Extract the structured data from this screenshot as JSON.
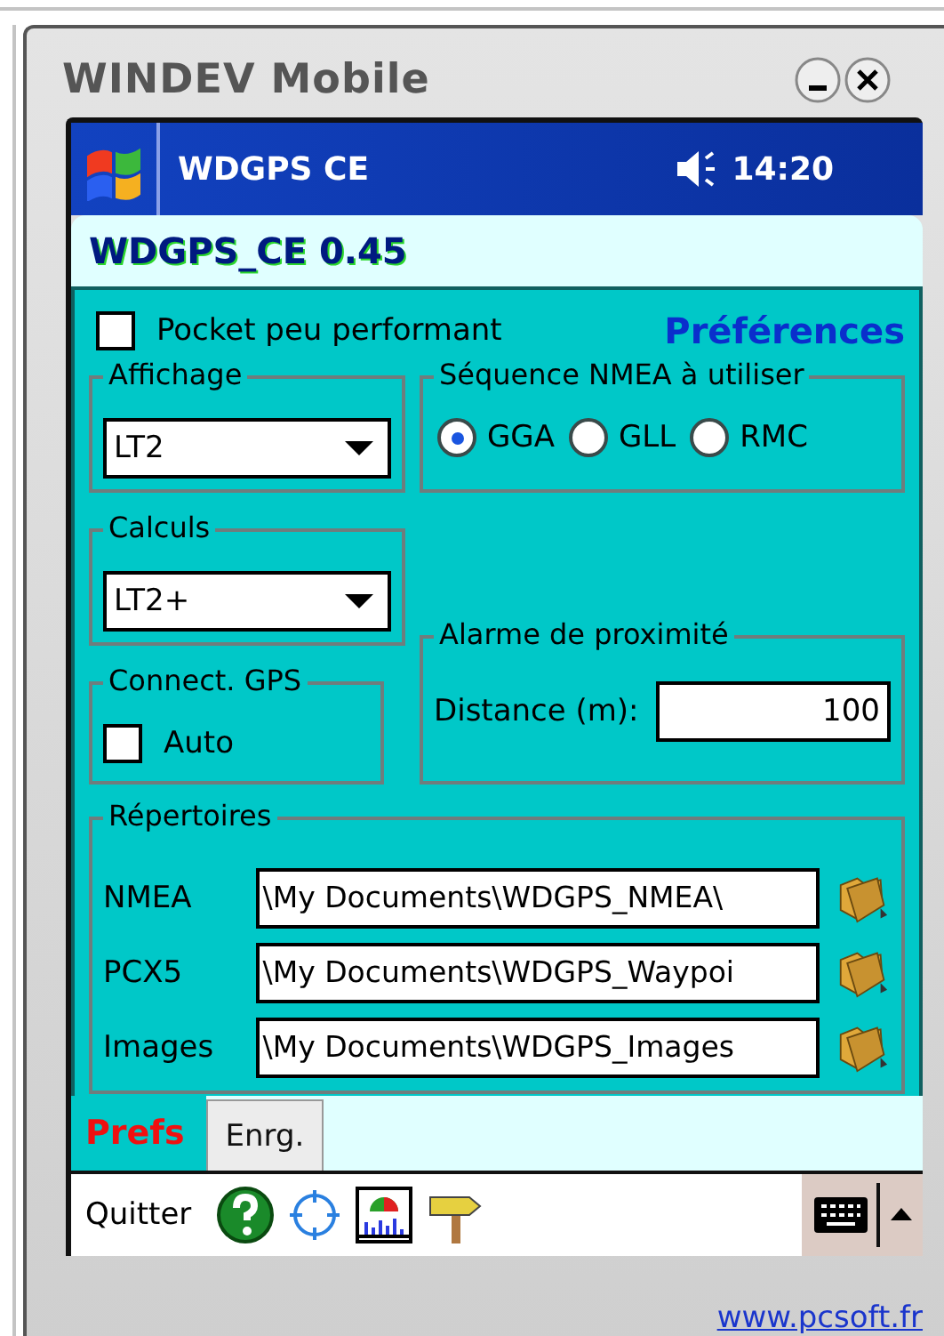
{
  "window": {
    "title": "WINDEV Mobile"
  },
  "status_bar": {
    "app_name": "WDGPS CE",
    "time": "14:20"
  },
  "app_title": "WDGPS_CE 0.45",
  "low_power": {
    "label": "Pocket peu performant",
    "checked": false
  },
  "heading": "Préférences",
  "display": {
    "title": "Affichage",
    "value": "LT2"
  },
  "nmea_sequence": {
    "title": "Séquence NMEA à utiliser",
    "options": [
      {
        "label": "GGA",
        "selected": true
      },
      {
        "label": "GLL",
        "selected": false
      },
      {
        "label": "RMC",
        "selected": false
      }
    ]
  },
  "calculations": {
    "title": "Calculs",
    "value": "LT2+"
  },
  "gps_connection": {
    "title": "Connect. GPS",
    "auto": {
      "label": "Auto",
      "checked": false
    }
  },
  "proximity_alarm": {
    "title": "Alarme de proximité",
    "distance_label": "Distance (m):",
    "distance": "100"
  },
  "directories": {
    "title": "Répertoires",
    "rows": [
      {
        "label": "NMEA",
        "path": "\\My Documents\\WDGPS_NMEA\\"
      },
      {
        "label": "PCX5",
        "path": "\\My Documents\\WDGPS_Waypoi"
      },
      {
        "label": "Images",
        "path": "\\My Documents\\WDGPS_Images"
      }
    ]
  },
  "tabs": [
    {
      "label": "Prefs",
      "selected": true
    },
    {
      "label": "Enrg.",
      "selected": false
    }
  ],
  "menu_bar": {
    "quit": "Quitter"
  },
  "footer_link": "www.pcsoft.fr"
}
